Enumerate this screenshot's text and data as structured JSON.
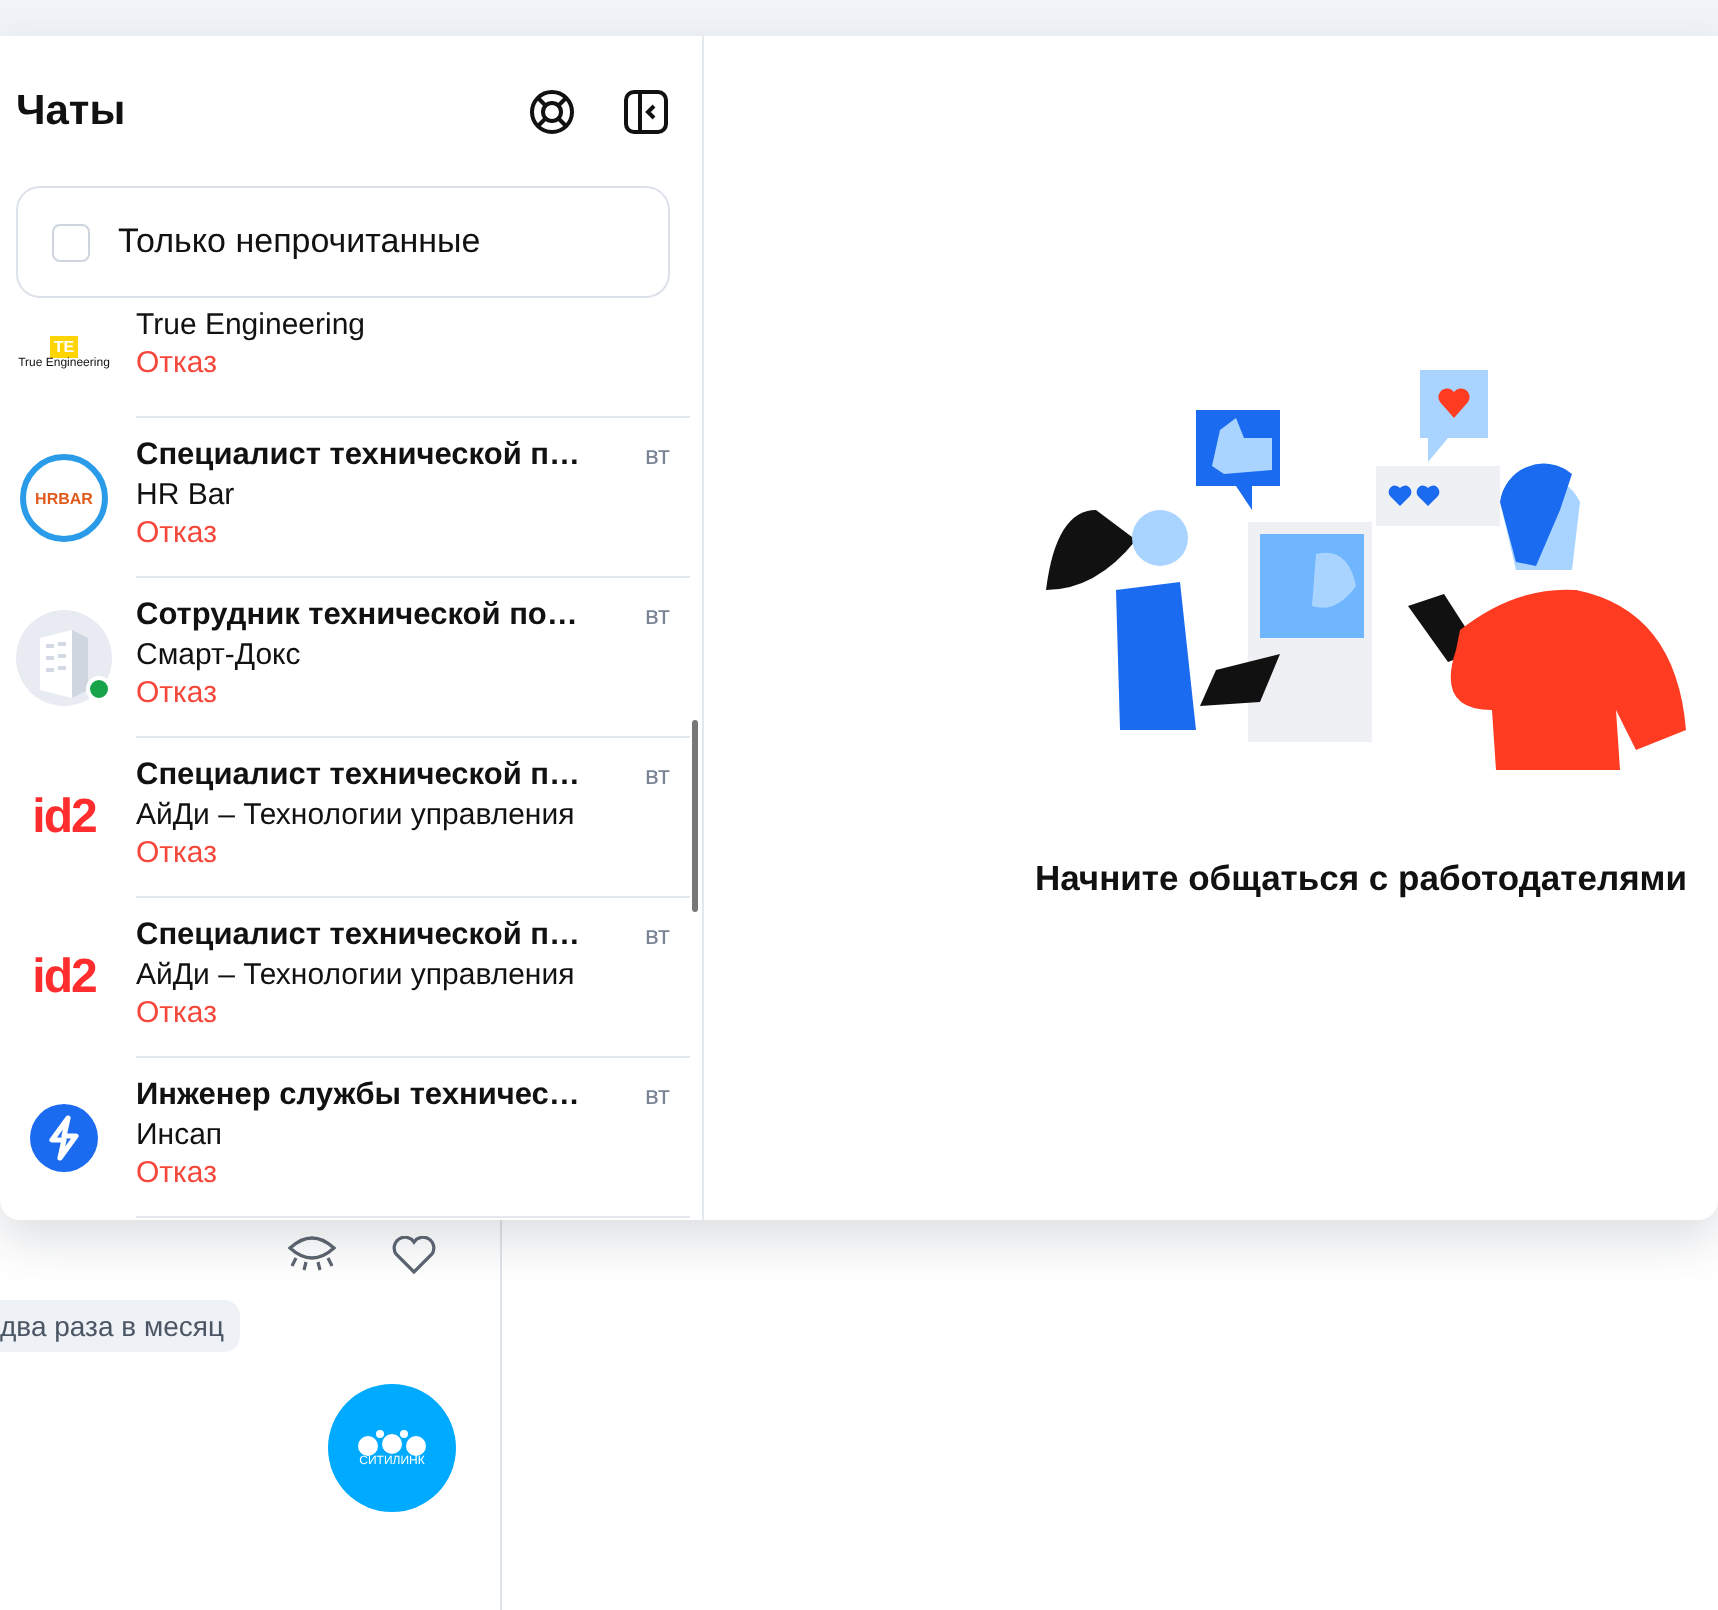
{
  "chats_panel": {
    "title": "Чаты",
    "unread_filter": {
      "label": "Только непрочитанные",
      "checked": false
    },
    "items": [
      {
        "kind": "true-engineering",
        "logo_badge": "TE",
        "logo_text": "True Engineering",
        "company": "True Engineering",
        "status": "Отказ",
        "online": false
      },
      {
        "kind": "hrbar",
        "logo_text": "HRBAR",
        "title": "Специалист технической п…",
        "date": "вт",
        "company": "HR Bar",
        "status": "Отказ",
        "online": false
      },
      {
        "kind": "building",
        "title": "Сотрудник технической по…",
        "date": "вт",
        "company": "Смарт-Докс",
        "status": "Отказ",
        "online": true
      },
      {
        "kind": "id2",
        "logo_text": "id2",
        "title": "Специалист технической п…",
        "date": "вт",
        "company": "АйДи – Технологии управления",
        "status": "Отказ",
        "online": false
      },
      {
        "kind": "id2",
        "logo_text": "id2",
        "title": "Специалист технической п…",
        "date": "вт",
        "company": "АйДи – Технологии управления",
        "status": "Отказ",
        "online": false
      },
      {
        "kind": "insap",
        "title": "Инженер службы техничес…",
        "date": "вт",
        "company": "Инсап",
        "status": "Отказ",
        "online": false
      }
    ]
  },
  "empty_state": {
    "message": "Начните общаться с работодателями"
  },
  "background_vacancy": {
    "tag": "два раза в месяц",
    "logo_text": "СИТИЛИНК"
  }
}
